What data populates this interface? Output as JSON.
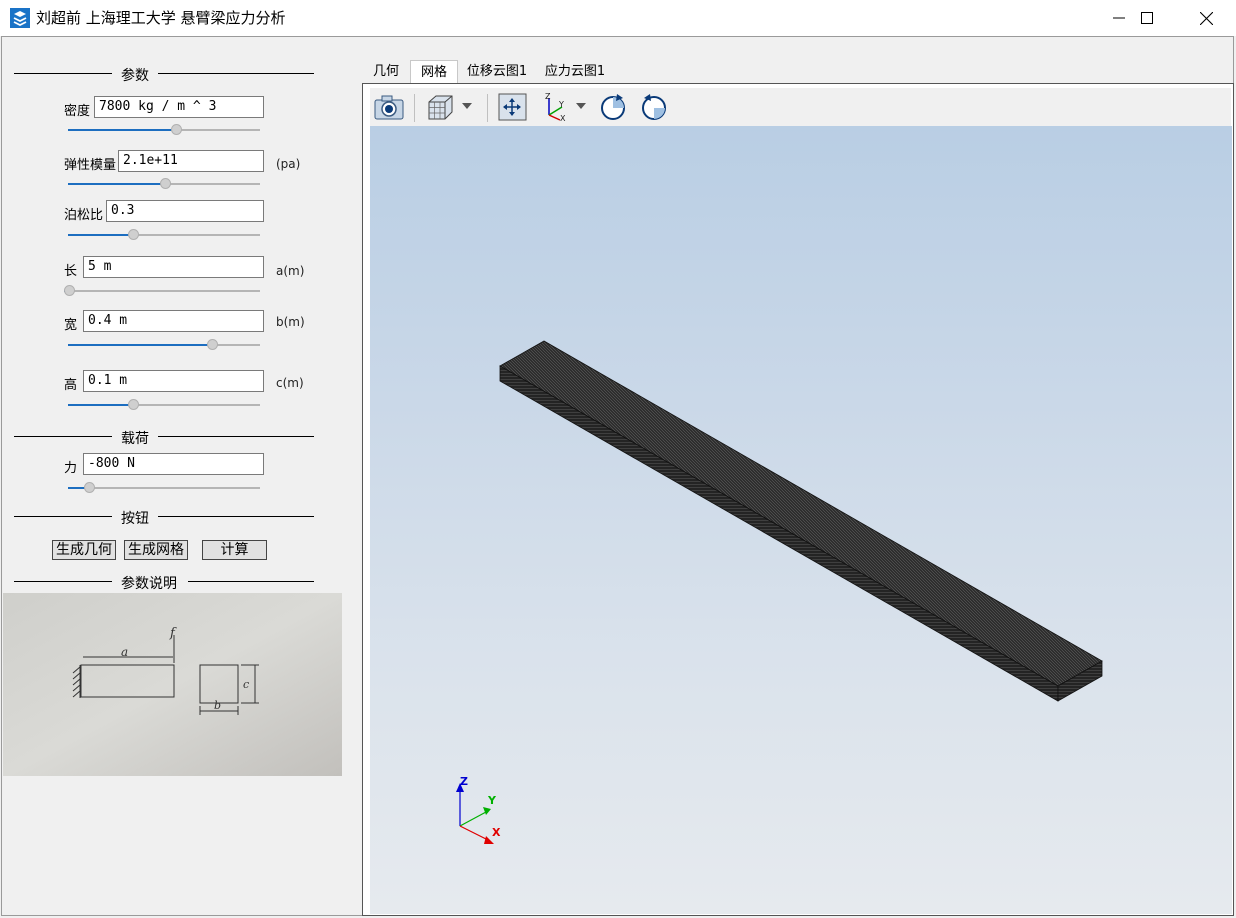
{
  "window": {
    "title": "刘超前 上海理工大学 悬臂梁应力分析",
    "controls": [
      "minimize",
      "maximize",
      "close"
    ]
  },
  "sections": {
    "params": "参数",
    "load": "载荷",
    "buttons": "按钮",
    "description": "参数说明"
  },
  "params": {
    "density": {
      "label": "密度",
      "value": "7800 kg / m ^ 3",
      "unit": "",
      "slider": 0.57
    },
    "modulus": {
      "label": "弹性模量",
      "value": "2.1e+11",
      "unit": "(pa)",
      "slider": 0.51
    },
    "poisson": {
      "label": "泊松比",
      "value": "0.3",
      "unit": "",
      "slider": 0.33
    },
    "length": {
      "label": "长",
      "value": "5 m",
      "unit": "a(m)",
      "slider": 0.0
    },
    "width": {
      "label": "宽",
      "value": "0.4 m",
      "unit": "b(m)",
      "slider": 0.77
    },
    "height": {
      "label": "高",
      "value": "0.1 m",
      "unit": "c(m)",
      "slider": 0.33
    }
  },
  "load": {
    "force": {
      "label": "力",
      "value": "-800 N",
      "slider": 0.09
    }
  },
  "actions": {
    "gen_geometry": "生成几何",
    "gen_mesh": "生成网格",
    "compute": "计算"
  },
  "sketch": {
    "a": "a",
    "b": "b",
    "c": "c",
    "f": "f"
  },
  "tabs": [
    {
      "label": "几何"
    },
    {
      "label": "网格",
      "active": true
    },
    {
      "label": "位移云图1"
    },
    {
      "label": "应力云图1"
    }
  ],
  "toolbar": [
    "camera-icon",
    "view-cube-icon",
    "dropdown-icon",
    "fit-all-icon",
    "axes-view-icon",
    "dropdown-icon",
    "rotate-cw-icon",
    "rotate-ccw-icon"
  ],
  "axes_triad": {
    "x": "X",
    "y": "Y",
    "z": "Z"
  },
  "colors": {
    "accent": "#1d6ec0",
    "x_axis": "#e00000",
    "y_axis": "#00b000",
    "z_axis": "#0000d0"
  }
}
